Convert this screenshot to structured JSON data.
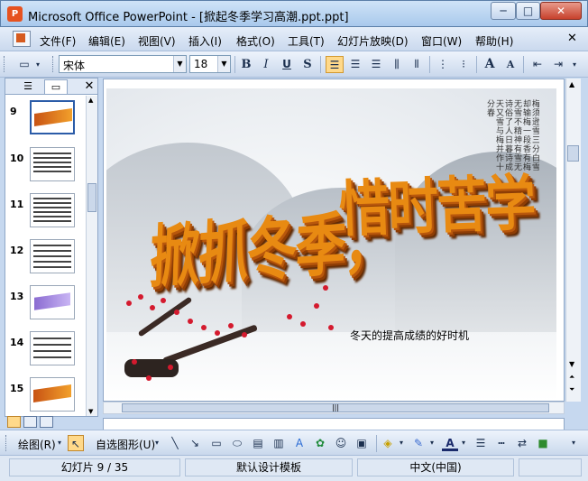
{
  "window": {
    "app_icon": "P",
    "title": "Microsoft Office PowerPoint - [掀起冬季学习高潮.ppt.ppt]",
    "min_label": "─",
    "max_label": "□",
    "close_label": "✕"
  },
  "menu": {
    "items": [
      "文件(F)",
      "编辑(E)",
      "视图(V)",
      "插入(I)",
      "格式(O)",
      "工具(T)",
      "幻灯片放映(D)",
      "窗口(W)",
      "帮助(H)"
    ],
    "close_label": "✕"
  },
  "toolbar": {
    "font_name": "宋体",
    "font_size": "18",
    "bold_label": "B",
    "italic_label": "I",
    "underline_label": "U",
    "shadow_label": "S",
    "grow_font_label": "A",
    "shrink_font_label": "A"
  },
  "panel": {
    "slide_numbers": [
      "9",
      "10",
      "11",
      "12",
      "13",
      "14",
      "15"
    ],
    "selected_slide": "9",
    "close_label": "✕"
  },
  "slide": {
    "title_left": "掀抓冬季，",
    "title_right": "惜时苦学",
    "poem": "梅须逊雪三分白雪却输梅一段香有梅无雪不精神有雪无诗俗了人日暮诗成天又雪与梅并作十分春",
    "subtitle": "冬天的提高成绩的好时机"
  },
  "drawbar": {
    "draw_label": "绘图(R)",
    "autoshapes_label": "自选图形(U)"
  },
  "status": {
    "slide_info": "幻灯片 9 / 35",
    "template": "默认设计模板",
    "language": "中文(中国)"
  },
  "colors": {
    "title_orange": "#e88a12",
    "blossom_red": "#d41a2e",
    "active_highlight": "#ffd98a"
  }
}
